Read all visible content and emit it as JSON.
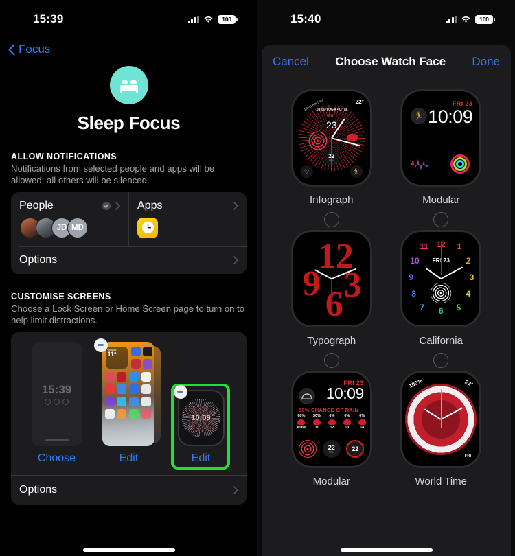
{
  "left": {
    "status": {
      "time": "15:39",
      "battery": "100",
      "signal_icon": "cellular-bars-icon",
      "wifi_icon": "wifi-icon"
    },
    "back": {
      "label": "Focus",
      "icon": "chevron-left-icon"
    },
    "hero": {
      "icon": "bed-icon",
      "title": "Sleep Focus",
      "icon_color": "#6fe3d4"
    },
    "allow": {
      "header": "ALLOW NOTIFICATIONS",
      "subtitle": "Notifications from selected people and apps will be allowed; all others will be silenced.",
      "people": {
        "label": "People",
        "avatars": [
          {
            "type": "photo",
            "initials": ""
          },
          {
            "type": "photo",
            "initials": ""
          },
          {
            "type": "initials",
            "initials": "JD"
          },
          {
            "type": "initials",
            "initials": "MD"
          }
        ]
      },
      "apps": {
        "label": "Apps",
        "app_icon": "clock-icon"
      },
      "options": {
        "label": "Options"
      }
    },
    "customise": {
      "header": "CUSTOMISE SCREENS",
      "subtitle": "Choose a Lock Screen or Home Screen page to turn on to help limit distractions.",
      "screens": [
        {
          "kind": "lock",
          "time": "15:39",
          "caption": "Choose",
          "has_minus": false,
          "highlighted": false
        },
        {
          "kind": "home",
          "widget_temp": "11°",
          "widget_city": "Wroclaw",
          "caption": "Edit",
          "has_minus": true,
          "highlighted": false
        },
        {
          "kind": "watch",
          "time": "10:09",
          "caption": "Edit",
          "has_minus": true,
          "highlighted": true
        }
      ],
      "highlight_color": "#22e033",
      "options": {
        "label": "Options"
      }
    }
  },
  "right": {
    "status": {
      "time": "15:40",
      "battery": "100",
      "signal_icon": "cellular-bars-icon",
      "wifi_icon": "wifi-icon"
    },
    "sheet": {
      "cancel": "Cancel",
      "title": "Choose Watch Face",
      "done": "Done",
      "faces": [
        {
          "id": "infograph",
          "label": "Infograph",
          "selected": false,
          "date": "FRI",
          "day": "23",
          "temp": "22°",
          "steps": "19:03  6m 53m",
          "schedule": "08:00 YOGA • GYM",
          "sub": "22",
          "sub_label": "MPH"
        },
        {
          "id": "modular",
          "label": "Modular",
          "selected": false,
          "date": "FRI 23",
          "time": "10:09"
        },
        {
          "id": "typograph",
          "label": "Typograph",
          "selected": false,
          "numerals": [
            "12",
            "9",
            "3",
            "6"
          ]
        },
        {
          "id": "california",
          "label": "California",
          "selected": false,
          "date": "FRI 23",
          "numerals": [
            "1",
            "2",
            "3",
            "4",
            "5",
            "6",
            "7",
            "8",
            "9",
            "10",
            "11",
            "12"
          ]
        },
        {
          "id": "modular-compact",
          "label": "Modular",
          "selected": false,
          "date": "FRI 23",
          "time": "10:09",
          "rain_title": "60% CHANCE OF RAIN",
          "forecast": [
            {
              "pct": "60%",
              "hour": "NOW"
            },
            {
              "pct": "30%",
              "hour": "11"
            },
            {
              "pct": "0%",
              "hour": "12"
            },
            {
              "pct": "0%",
              "hour": "13"
            },
            {
              "pct": "0%",
              "hour": "14"
            }
          ],
          "wind": "22",
          "wind_unit": "MPH",
          "uv": "22"
        },
        {
          "id": "world-time",
          "label": "World Time",
          "selected": false,
          "battery": "100%",
          "temp": "22°",
          "date": "FRI"
        }
      ]
    }
  }
}
